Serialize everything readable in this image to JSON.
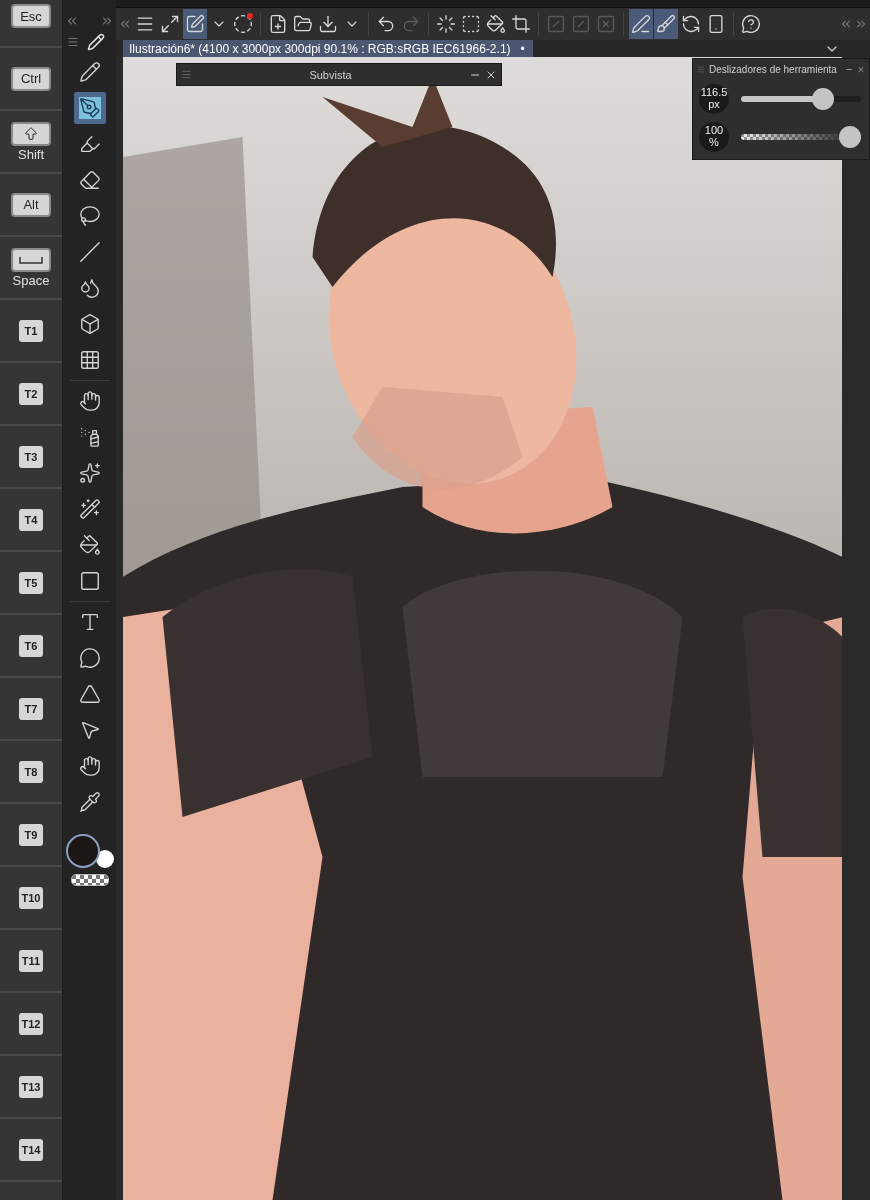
{
  "keys": [
    {
      "kind": "label",
      "label": "Esc"
    },
    {
      "kind": "label",
      "label": "Ctrl"
    },
    {
      "kind": "shift",
      "caption": "Shift"
    },
    {
      "kind": "label",
      "label": "Alt"
    },
    {
      "kind": "space",
      "caption": "Space"
    },
    {
      "kind": "label",
      "label": "T1"
    },
    {
      "kind": "label",
      "label": "T2"
    },
    {
      "kind": "label",
      "label": "T3"
    },
    {
      "kind": "label",
      "label": "T4"
    },
    {
      "kind": "label",
      "label": "T5"
    },
    {
      "kind": "label",
      "label": "T6"
    },
    {
      "kind": "label",
      "label": "T7"
    },
    {
      "kind": "label",
      "label": "T8"
    },
    {
      "kind": "label",
      "label": "T9"
    },
    {
      "kind": "label",
      "label": "T10"
    },
    {
      "kind": "label",
      "label": "T11"
    },
    {
      "kind": "label",
      "label": "T12"
    },
    {
      "kind": "label",
      "label": "T13"
    },
    {
      "kind": "label",
      "label": "T14"
    }
  ],
  "tool_groups": [
    [
      {
        "kind": "pencil",
        "selected": false
      },
      {
        "kind": "pen",
        "selected": true
      },
      {
        "kind": "marker",
        "selected": false
      },
      {
        "kind": "eraser",
        "selected": false
      },
      {
        "kind": "lasso",
        "selected": false
      },
      {
        "kind": "line",
        "selected": false
      },
      {
        "kind": "drops",
        "selected": false
      },
      {
        "kind": "cube",
        "selected": false
      },
      {
        "kind": "grid",
        "selected": false
      }
    ],
    [
      {
        "kind": "hand",
        "selected": false
      },
      {
        "kind": "spray",
        "selected": false
      },
      {
        "kind": "sparkles",
        "selected": false
      },
      {
        "kind": "wand",
        "selected": false
      },
      {
        "kind": "bucket",
        "selected": false
      },
      {
        "kind": "gradient",
        "selected": false
      }
    ],
    [
      {
        "kind": "text",
        "selected": false
      },
      {
        "kind": "balloon",
        "selected": false
      },
      {
        "kind": "ruler",
        "selected": false
      },
      {
        "kind": "cursor",
        "selected": false
      },
      {
        "kind": "hand",
        "selected": false
      },
      {
        "kind": "eyedropper",
        "selected": false
      }
    ]
  ],
  "toolbar_groups": [
    [
      {
        "kind": "menu",
        "selected": false,
        "disabled": false
      },
      {
        "kind": "fit",
        "selected": false,
        "disabled": false
      },
      {
        "kind": "transform",
        "selected": true,
        "disabled": false
      },
      {
        "kind": "caret",
        "selected": false,
        "disabled": false
      },
      {
        "kind": "spiral",
        "selected": false,
        "disabled": false
      }
    ],
    [
      {
        "kind": "new",
        "selected": false,
        "disabled": false
      },
      {
        "kind": "open",
        "selected": false,
        "disabled": false
      },
      {
        "kind": "save",
        "selected": false,
        "disabled": false
      },
      {
        "kind": "caret",
        "selected": false,
        "disabled": false
      }
    ],
    [
      {
        "kind": "undo",
        "selected": false,
        "disabled": false
      },
      {
        "kind": "redo",
        "selected": false,
        "disabled": true
      }
    ],
    [
      {
        "kind": "loader",
        "selected": false,
        "disabled": false
      },
      {
        "kind": "selection",
        "selected": false,
        "disabled": false
      },
      {
        "kind": "fill",
        "selected": false,
        "disabled": false
      },
      {
        "kind": "crop",
        "selected": false,
        "disabled": false
      }
    ],
    [
      {
        "kind": "clear",
        "selected": false,
        "disabled": true
      },
      {
        "kind": "invert",
        "selected": false,
        "disabled": true
      },
      {
        "kind": "border",
        "selected": false,
        "disabled": true
      }
    ],
    [
      {
        "kind": "edit",
        "selected": true,
        "disabled": false
      },
      {
        "kind": "brush",
        "selected": true,
        "disabled": false
      },
      {
        "kind": "rotate",
        "selected": false,
        "disabled": false
      },
      {
        "kind": "phone",
        "selected": false,
        "disabled": false
      }
    ],
    [
      {
        "kind": "help",
        "selected": false,
        "disabled": false
      }
    ]
  ],
  "document_tab": {
    "title": "Ilustración6* (4100 x 3000px 300dpi 90.1% : RGB:sRGB IEC61966-2.1)",
    "modified_mark": "•"
  },
  "subview": {
    "title": "Subvista"
  },
  "tool_sliders": {
    "title": "Deslizadores de herramienta",
    "sliders": [
      {
        "kind": "solid",
        "reading": "116.5",
        "unit": "px",
        "level": 0.72
      },
      {
        "kind": "checker",
        "reading": "100",
        "unit": "%",
        "level": 1
      }
    ]
  },
  "canvas": {
    "kind": "picture"
  }
}
